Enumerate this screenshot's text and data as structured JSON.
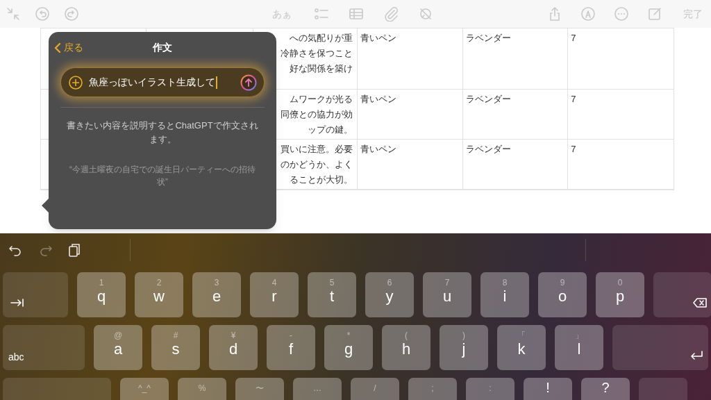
{
  "toolbar": {
    "left": [
      {
        "kind": "shrink"
      },
      {
        "kind": "undo"
      },
      {
        "kind": "redo"
      }
    ],
    "center": [
      {
        "kind": "text",
        "label": "あぁ"
      },
      {
        "kind": "checklist"
      },
      {
        "kind": "table"
      },
      {
        "kind": "attach"
      },
      {
        "kind": "magic"
      }
    ],
    "right": [
      {
        "kind": "share"
      },
      {
        "kind": "markup"
      },
      {
        "kind": "more"
      },
      {
        "kind": "compose"
      },
      {
        "kind": "text",
        "label": "完了"
      }
    ]
  },
  "table": {
    "rows": [
      {
        "column_3": [
          "への気配りが重",
          "冷静さを保つこと",
          "好な関係を築け"
        ],
        "column_4": "青いペン",
        "column_5": "ラベンダー",
        "column_6": "7"
      },
      {
        "column_3": [
          "ムワークが光る",
          "同僚との協力が効",
          "ップの鍵。"
        ],
        "column_4": "青いペン",
        "column_5": "ラベンダー",
        "column_6": "7"
      },
      {
        "column_3": [
          "買いに注意。必要",
          "のかどうか、よく",
          "ることが大切。"
        ],
        "column_4": "青いペン",
        "column_5": "ラベンダー",
        "column_6": "7"
      }
    ]
  },
  "popover": {
    "back": "戻る",
    "title": "作文",
    "input": {
      "value": "魚座っぽいイラスト生成して"
    },
    "description": "書きたい内容を説明するとChatGPTで作文されます。",
    "example": "“今週土曜夜の自宅での誕生日パーティーへの招待状”"
  },
  "keyboard": {
    "shortcuts": [
      {
        "kind": "undo",
        "disabled": false
      },
      {
        "kind": "redo",
        "disabled": true
      },
      {
        "kind": "paste",
        "disabled": false
      }
    ],
    "rows": [
      [
        {
          "kind": "tab"
        },
        {
          "kind": "char",
          "label": "q",
          "alt": "1"
        },
        {
          "kind": "char",
          "label": "w",
          "alt": "2"
        },
        {
          "kind": "char",
          "label": "e",
          "alt": "3"
        },
        {
          "kind": "char",
          "label": "r",
          "alt": "4"
        },
        {
          "kind": "char",
          "label": "t",
          "alt": "5"
        },
        {
          "kind": "char",
          "label": "y",
          "alt": "6"
        },
        {
          "kind": "char",
          "label": "u",
          "alt": "7"
        },
        {
          "kind": "char",
          "label": "i",
          "alt": "8"
        },
        {
          "kind": "char",
          "label": "o",
          "alt": "9"
        },
        {
          "kind": "char",
          "label": "p",
          "alt": "0"
        },
        {
          "kind": "delete"
        }
      ],
      [
        {
          "kind": "mode",
          "label": "abc"
        },
        {
          "kind": "char",
          "label": "a",
          "alt": "@"
        },
        {
          "kind": "char",
          "label": "s",
          "alt": "#"
        },
        {
          "kind": "char",
          "label": "d",
          "alt": "¥"
        },
        {
          "kind": "char",
          "label": "f",
          "alt": "-"
        },
        {
          "kind": "char",
          "label": "g",
          "alt": "*"
        },
        {
          "kind": "char",
          "label": "h",
          "alt": "("
        },
        {
          "kind": "char",
          "label": "j",
          "alt": ")"
        },
        {
          "kind": "char",
          "label": "k",
          "alt": "「"
        },
        {
          "kind": "char",
          "label": "l",
          "alt": "」"
        },
        {
          "kind": "return"
        }
      ],
      [
        {
          "kind": "shift"
        },
        {
          "kind": "char",
          "alt": "^_^"
        },
        {
          "kind": "char",
          "alt": "%"
        },
        {
          "kind": "char",
          "alt": "〜"
        },
        {
          "kind": "char",
          "alt": "…"
        },
        {
          "kind": "char",
          "alt": "/"
        },
        {
          "kind": "char",
          "alt": ";"
        },
        {
          "kind": "char",
          "alt": ":"
        },
        {
          "kind": "char",
          "label": "!"
        },
        {
          "kind": "char",
          "label": "?"
        },
        {
          "kind": "blank"
        }
      ]
    ]
  }
}
